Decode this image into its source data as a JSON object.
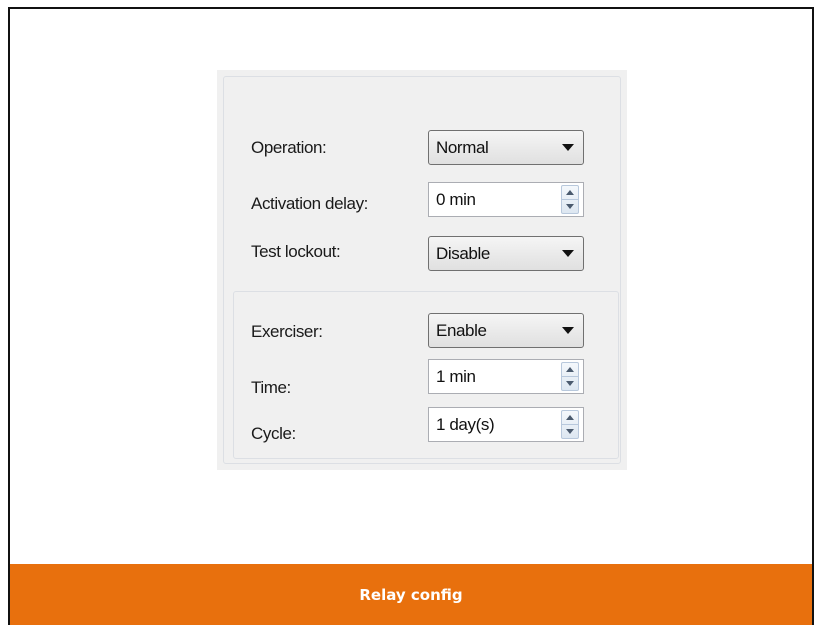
{
  "form": {
    "operation": {
      "label": "Operation:",
      "value": "Normal",
      "icon": "chevron-down-icon"
    },
    "activation_delay": {
      "label": "Activation delay:",
      "value": "0 min",
      "icon": "spinner-arrows-icon"
    },
    "test_lockout": {
      "label": "Test lockout:",
      "value": "Disable",
      "icon": "chevron-down-icon"
    },
    "exerciser_group": {
      "exerciser": {
        "label": "Exerciser:",
        "value": "Enable",
        "icon": "chevron-down-icon"
      },
      "time": {
        "label": "Time:",
        "value": "1 min",
        "icon": "spinner-arrows-icon"
      },
      "cycle": {
        "label": "Cycle:",
        "value": "1 day(s)",
        "icon": "spinner-arrows-icon"
      }
    }
  },
  "caption": "Relay config",
  "colors": {
    "caption_bar": "#e8700d",
    "caption_text": "#ffffff",
    "panel_background": "#f0f0f0"
  }
}
